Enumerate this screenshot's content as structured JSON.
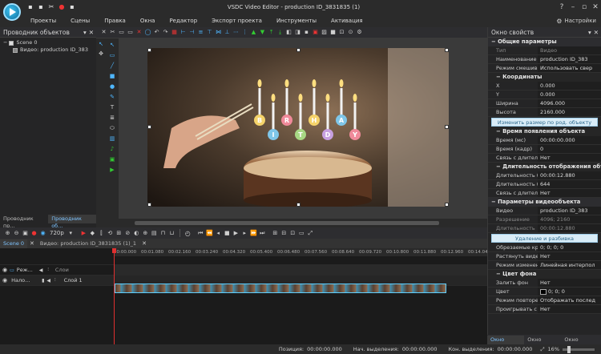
{
  "app": {
    "title": "VSDC Video Editor - production ID_3831835 (1)",
    "settings_label": "Настройки"
  },
  "menu": [
    "Проекты",
    "Сцены",
    "Правка",
    "Окна",
    "Редактор",
    "Экспорт проекта",
    "Инструменты",
    "Активация"
  ],
  "left_panel": {
    "title": "Проводник объектов",
    "tree": [
      {
        "label": "Scene 0"
      },
      {
        "label": "Видео: production ID_383"
      }
    ],
    "tabs": [
      "Проводник пр...",
      "Проводник об..."
    ]
  },
  "preview": {
    "quality": "720p",
    "candle_letters": [
      "B",
      "I",
      "R",
      "T",
      "H",
      "D",
      "A",
      "Y"
    ]
  },
  "right_panel": {
    "title": "Окно свойств",
    "general_section": "Общие параметры",
    "type_row": {
      "key": "Тип",
      "value": "Видео"
    },
    "name_row": {
      "key": "Наименование",
      "value": "production ID_383"
    },
    "blend_row": {
      "key": "Режим смешива",
      "value": "Использовать свер"
    },
    "coords_section": "Координаты",
    "x_row": {
      "key": "X",
      "value": "0.000"
    },
    "y_row": {
      "key": "Y",
      "value": "0.000"
    },
    "width_row": {
      "key": "Ширина",
      "value": "4096.000"
    },
    "height_row": {
      "key": "Высота",
      "value": "2160.000"
    },
    "resize_button": "Изменить размер по род. объекту",
    "appear_section": "Время появления объекта",
    "time_ms_row": {
      "key": "Время (мс)",
      "value": "00:00:00.000"
    },
    "time_frame_row": {
      "key": "Время (кадр)",
      "value": "0"
    },
    "link_row1": {
      "key": "Связь с длител",
      "value": "Нет"
    },
    "duration_section": "Длительность отображения объекта",
    "dur_ms_row": {
      "key": "Длительность (",
      "value": "00:00:12.880"
    },
    "dur_frame_row": {
      "key": "Длительность (",
      "value": "644"
    },
    "link_row2": {
      "key": "Связь с длител",
      "value": "Нет"
    },
    "video_params_section": "Параметры видеообъекта",
    "video_row": {
      "key": "Видео",
      "value": "production ID_383"
    },
    "resolution_row": {
      "key": "Разрешение",
      "value": "4096; 2160"
    },
    "length_row": {
      "key": "Длительность",
      "value": "00:00:12.880"
    },
    "delete_button": "Удаление и разбивка",
    "crop_row": {
      "key": "Обрезаемые края",
      "value": "0; 0; 0; 0"
    },
    "stretch_row": {
      "key": "Растянуть видео",
      "value": "Нет"
    },
    "resize_mode_row": {
      "key": "Режим изменени",
      "value": "Линейная интерпол"
    },
    "bg_section": "Цвет фона",
    "fill_row": {
      "key": "Залить фон",
      "value": "Нет"
    },
    "color_row": {
      "key": "Цвет",
      "value": "0; 0; 0"
    },
    "repeat_row": {
      "key": "Режим повторен",
      "value": "Отображать послед"
    },
    "play_row": {
      "key": "Проигрывать с к",
      "value": "Нет"
    },
    "bottom_tabs": [
      "Окно свой...",
      "Окно ресу...",
      "Окно базов..."
    ]
  },
  "timeline": {
    "tabs": [
      "Scene 0",
      "Видео: production ID_3831835 (1)_1"
    ],
    "ruler": [
      "00:00.000",
      "00:01.080",
      "00:02.160",
      "00:03.240",
      "00:04.320",
      "00:05.400",
      "00:06.480",
      "00:07.560",
      "00:08.640",
      "00:09.720",
      "00:10.800",
      "00:11.880",
      "00:12.960",
      "00:14.04"
    ],
    "track1": {
      "name": "Реж...",
      "layer": "Слои"
    },
    "track2": {
      "name": "Нало...",
      "layer": "Слой 1"
    }
  },
  "status": {
    "position_label": "Позиция:",
    "position_value": "00:00:00.000",
    "sel_start_label": "Нач. выделения:",
    "sel_start_value": "00:00:00.000",
    "sel_end_label": "Кон. выделения:",
    "sel_end_value": "00:00:00.000",
    "zoom": "16%"
  },
  "colors": {
    "accent": "#4fb7ff",
    "timeline_cursor": "#e03030",
    "clip": "#3f8fb0"
  }
}
